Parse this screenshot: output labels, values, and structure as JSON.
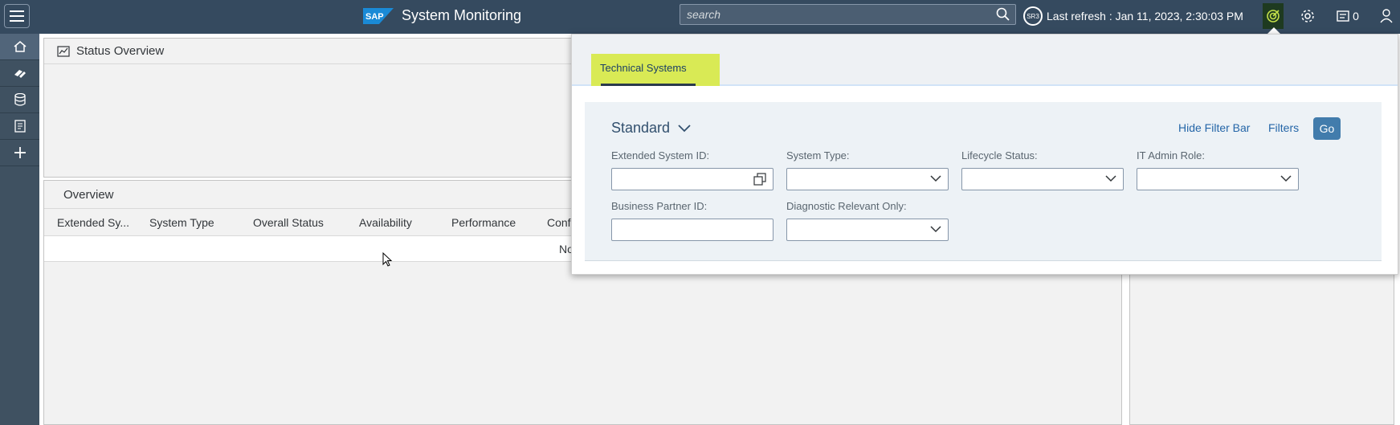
{
  "shell": {
    "app_title": "System Monitoring",
    "brand_text": "SAP",
    "search_placeholder": "search",
    "refresh_badge": "SR3",
    "last_refresh": "Last refresh : Jan 11, 2023, 2:30:03 PM",
    "notifications_count": "0"
  },
  "sidenav": {
    "items": [
      "home",
      "systems",
      "database",
      "reports",
      "add"
    ]
  },
  "status_overview": {
    "title": "Status Overview"
  },
  "overview": {
    "title": "Overview",
    "columns": [
      "Extended Sy...",
      "System Type",
      "Overall Status",
      "Availability",
      "Performance",
      "Conf"
    ],
    "no_data": "No"
  },
  "popover": {
    "tab_label": "Technical Systems",
    "variant": "Standard",
    "hide_filter_bar": "Hide Filter Bar",
    "filters": "Filters",
    "go": "Go",
    "fields": [
      {
        "label": "Extended System ID:",
        "value": ""
      },
      {
        "label": "System Type:",
        "value": ""
      },
      {
        "label": "Lifecycle Status:",
        "value": ""
      },
      {
        "label": "IT Admin Role:",
        "value": ""
      },
      {
        "label": "Business Partner ID:",
        "value": ""
      },
      {
        "label": "Diagnostic Relevant Only:",
        "value": ""
      }
    ]
  },
  "colors": {
    "shell_bg": "#354a5f",
    "sidenav_bg": "#3f5161",
    "tab_highlight": "#d9ea55",
    "go_button": "#427cac"
  }
}
